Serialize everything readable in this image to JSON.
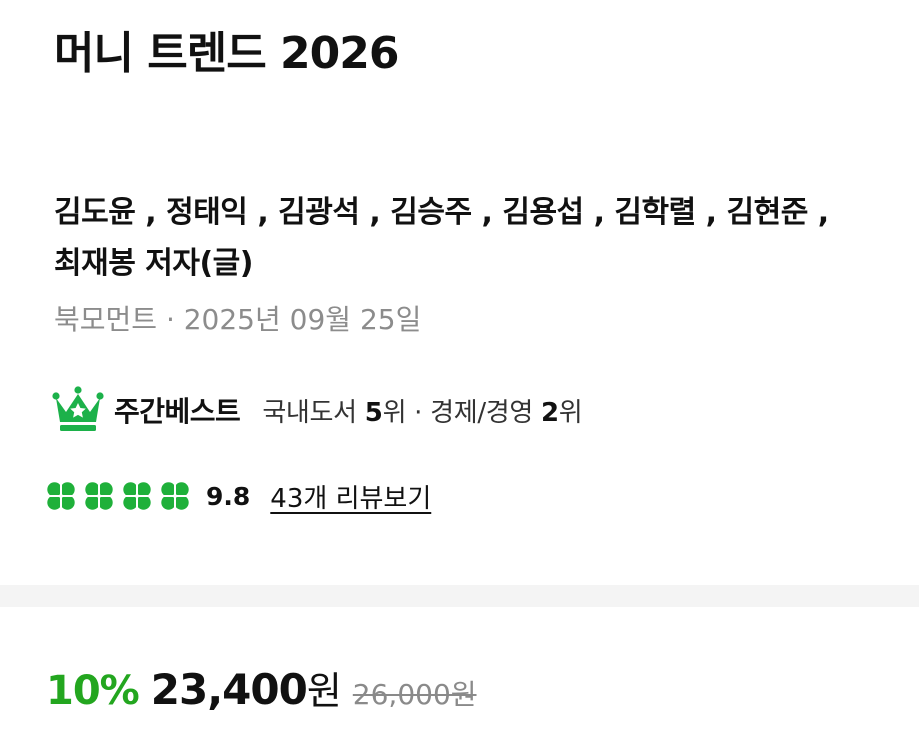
{
  "book": {
    "title": "머니 트렌드 2026",
    "authors_line1": "김도윤 , 정태익 , 김광석 , 김승주 , 김용섭 , 김학렬 , 김현준 ,",
    "authors_line2": "최재봉 저자(글)",
    "publisher_info": "북모먼트 · 2025년 09월 25일"
  },
  "bestseller": {
    "label": "주간베스트",
    "category1": "국내도서 ",
    "rank1": "5",
    "rank_unit1": "위 · ",
    "category2": "경제/경영 ",
    "rank2": "2",
    "rank_unit2": "위",
    "icon": "crown-icon"
  },
  "rating": {
    "score": "9.8",
    "clover_count": 4,
    "icon": "clover-icon",
    "review_link": "43개 리뷰보기"
  },
  "price": {
    "discount": "10%",
    "sale_price": "23,400",
    "sale_unit": "원",
    "original_price": "26,000원"
  },
  "colors": {
    "accent_green": "#23a61f",
    "clover_green": "#1fb03a",
    "crown_green": "#1cb14a"
  }
}
